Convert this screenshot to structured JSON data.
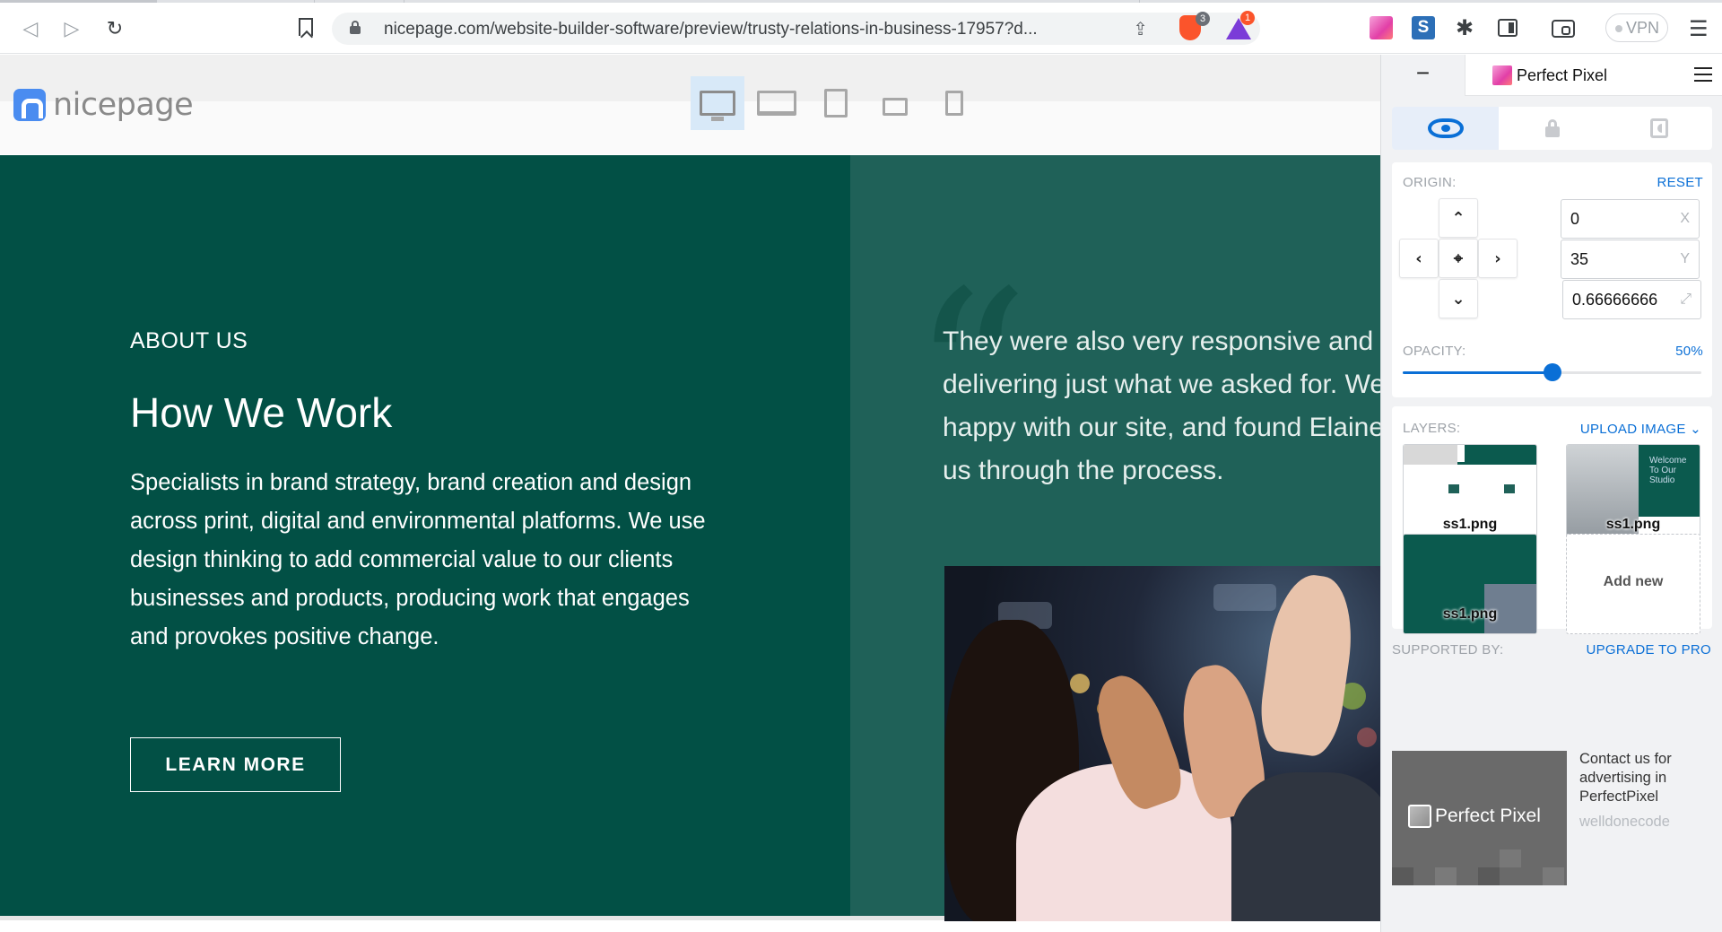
{
  "browser": {
    "url": "nicepage.com/website-builder-software/preview/trusty-relations-in-business-17957?d...",
    "brave_badge": "3",
    "rewards_badge": "1",
    "vpn_label": "VPN"
  },
  "site": {
    "logo_text": "nicepage",
    "devices": [
      "desktop",
      "laptop",
      "tablet",
      "tablet-landscape",
      "phone"
    ],
    "active_device": "desktop",
    "about": {
      "eyebrow": "ABOUT US",
      "title": "How We Work",
      "body": "Specialists in brand strategy, brand creation and design across print, digital and environmental platforms. We use design thinking to add commercial value to our clients businesses and products, producing work that engages and provokes positive change.",
      "cta": "LEARN MORE"
    },
    "testimonial": {
      "quote_mark": "“",
      "lines": [
        "They were also very responsive and fo",
        "delivering just what we asked for. We'",
        "happy with our site, and found Elaine",
        "us through the process."
      ]
    },
    "colors": {
      "left_bg": "#025045",
      "right_bg": "#1f6158"
    }
  },
  "perfect_pixel": {
    "title": "Perfect Pixel",
    "minimize": "−",
    "origin_label": "ORIGIN:",
    "reset_label": "RESET",
    "x_value": "0",
    "x_suffix": "X",
    "y_value": "35",
    "y_suffix": "Y",
    "scale_value": "0.66666666",
    "scale_suffix": "⤢",
    "opacity_label": "OPACITY:",
    "opacity_value_text": "50%",
    "opacity_fraction": 0.5,
    "layers_label": "LAYERS:",
    "upload_label": "UPLOAD IMAGE",
    "layers": [
      {
        "name": "ss1.png"
      },
      {
        "name": "ss1.png"
      },
      {
        "name": "ss1.png"
      }
    ],
    "add_new_label": "Add new",
    "supported_label": "SUPPORTED BY:",
    "upgrade_label": "UPGRADE TO PRO",
    "ad_brand": "Perfect Pixel",
    "ad_text": "Contact us for advertising in PerfectPixel",
    "ad_sub": "welldonecode",
    "accent": "#0a6fd6"
  }
}
